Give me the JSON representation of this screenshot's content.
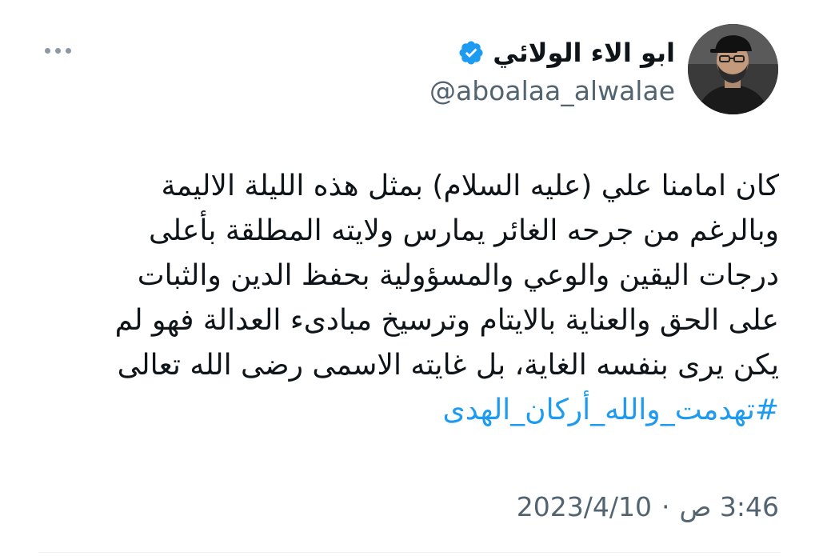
{
  "author": {
    "display_name": "ابو الاء الولائي",
    "handle": "@aboalaa_alwalae",
    "verified": true,
    "verified_icon": "verified-badge-icon",
    "verified_color": "#1d9bf0"
  },
  "actions": {
    "more_icon": "more-horizontal-icon"
  },
  "tweet": {
    "lines": [
      "كان امامنا علي (عليه السلام) بمثل هذه الليلة الاليمة",
      "وبالرغم من جرحه الغائر يمارس ولايته المطلقة بأعلى",
      "درجات اليقين والوعي والمسؤولية بحفظ الدين والثبات",
      "على الحق والعناية بالايتام وترسيخ مبادىء العدالة فهو لم",
      "يكن يرى بنفسه الغاية، بل غايته الاسمى رضى الله تعالى"
    ],
    "hashtag": "#تهدمت_والله_أركان_الهدى",
    "time": "3:46 ص",
    "separator": "·",
    "date": "2023/4/10"
  },
  "colors": {
    "text": "#0f1419",
    "secondary": "#536471",
    "link": "#1d9bf0"
  }
}
